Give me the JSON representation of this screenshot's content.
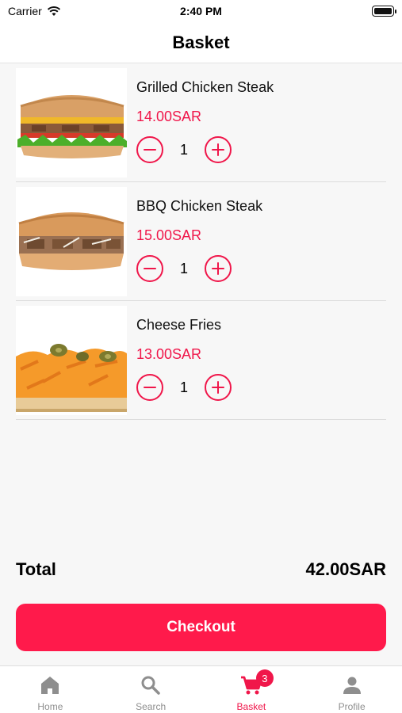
{
  "status_bar": {
    "carrier": "Carrier",
    "time": "2:40 PM"
  },
  "header": {
    "title": "Basket"
  },
  "items": [
    {
      "name": "Grilled Chicken Steak",
      "price": "14.00SAR",
      "quantity": "1",
      "image_icon": "sandwich-lettuce-cheese"
    },
    {
      "name": "BBQ Chicken Steak",
      "price": "15.00SAR",
      "quantity": "1",
      "image_icon": "sandwich-grilled-chicken"
    },
    {
      "name": "Cheese Fries",
      "price": "13.00SAR",
      "quantity": "1",
      "image_icon": "cheese-fries"
    }
  ],
  "summary": {
    "total_label": "Total",
    "total_value": "42.00SAR"
  },
  "checkout": {
    "label": "Checkout"
  },
  "tabs": [
    {
      "label": "Home",
      "icon": "home-icon",
      "active": false
    },
    {
      "label": "Search",
      "icon": "search-icon",
      "active": false
    },
    {
      "label": "Basket",
      "icon": "cart-icon",
      "active": true,
      "badge": "3"
    },
    {
      "label": "Profile",
      "icon": "person-icon",
      "active": false
    }
  ],
  "colors": {
    "accent": "#f0164a",
    "checkout_bg": "#ff1a4b",
    "inactive_tab": "#8e8e8e",
    "background": "#f7f7f7"
  }
}
